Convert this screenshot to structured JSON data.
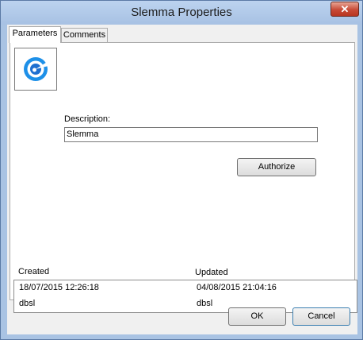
{
  "window": {
    "title": "Slemma Properties",
    "close_glyph": "✕"
  },
  "tabs": [
    {
      "label": "Parameters",
      "active": true
    },
    {
      "label": "Comments",
      "active": false
    }
  ],
  "parameters": {
    "icon": "slemma-logo-icon",
    "description_label": "Description:",
    "description_value": "Slemma",
    "authorize_label": "Authorize",
    "created_header": "Created",
    "updated_header": "Updated",
    "created_date": "18/07/2015 12:26:18",
    "created_by": "dbsl",
    "updated_date": "04/08/2015 21:04:16",
    "updated_by": "dbsl"
  },
  "buttons": {
    "ok": "OK",
    "cancel": "Cancel"
  },
  "colors": {
    "titlebar": "#a9c3e3",
    "close_button": "#c74a36",
    "logo_blue": "#1e90e8"
  }
}
